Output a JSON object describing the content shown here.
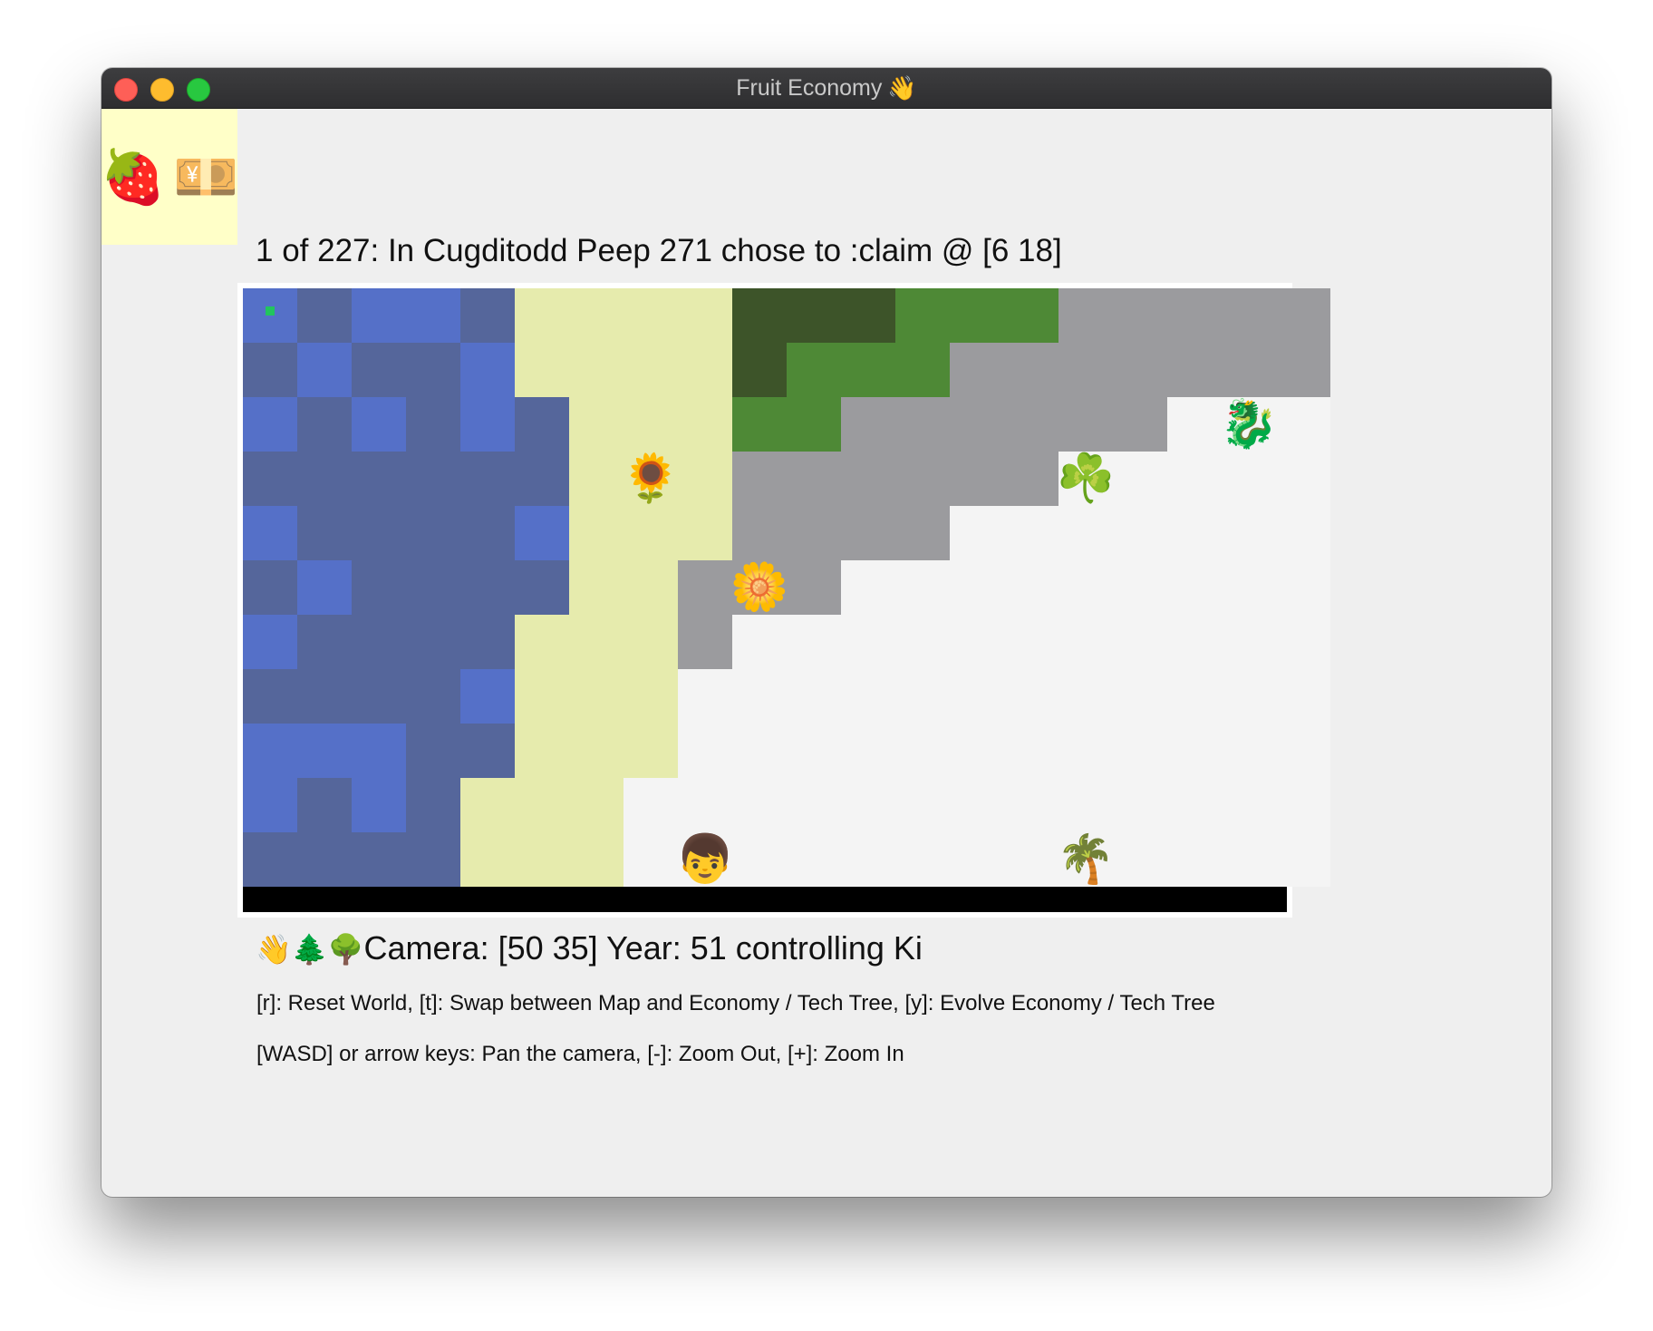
{
  "window": {
    "title": "Fruit Economy",
    "title_icon": "👋",
    "title_icon_name": "waving-hand-icon"
  },
  "resources": [
    {
      "name": "strawberry-icon",
      "glyph": "🍓"
    },
    {
      "name": "yen-banknote-icon",
      "glyph": "💴"
    }
  ],
  "event_log": "1 of 227: In Cugditodd Peep 271 chose to :claim @ [6 18]",
  "map": {
    "palette": {
      "W": "#5570c8",
      "D": "#55669b",
      "S": "#e6ebad",
      "F": "#3d5429",
      "G": "#4e8936",
      "R": "#9b9b9e",
      "N": "#f4f4f4"
    },
    "rows": [
      "WDWWDSSSSFFFGGGRRRRR",
      "DWDDWSSSSFGGGRRRRRRR",
      "WDWDWDSSSGGRRRRRRNNN",
      "DDDDDDSSSRRRRRRNNNNN",
      "WDDDDWSSSRRRRNNNNNNN",
      "DWDDDDSSRRRNNNNNNNNN",
      "WDDDDSSSRNNNNNNNNNNN",
      "DDDDWSSSNNNNNNNNNNNN",
      "WWWDDSSSNNNNNNNNNNNN",
      "WDWDSSSNNNNNNNNNNNNN",
      "DDDDSSSNNNNNNNNNNNNN"
    ],
    "sprites": [
      {
        "name": "sunflower-icon",
        "glyph": "🌻",
        "col": 7,
        "row": 3
      },
      {
        "name": "blossom-icon",
        "glyph": "🌼",
        "col": 9,
        "row": 5
      },
      {
        "name": "shamrock-icon",
        "glyph": "☘️",
        "col": 15,
        "row": 3
      },
      {
        "name": "dragon-icon",
        "glyph": "🐉",
        "col": 18,
        "row": 2
      },
      {
        "name": "person-icon",
        "glyph": "👦",
        "col": 8,
        "row": 10
      },
      {
        "name": "palm-tree-icon",
        "glyph": "🌴",
        "col": 15,
        "row": 10
      }
    ],
    "marker": {
      "col": 0,
      "row": 0,
      "color": "#22c55e"
    }
  },
  "status": {
    "icons": [
      {
        "name": "waving-hand-icon",
        "glyph": "👋"
      },
      {
        "name": "evergreen-tree-icon",
        "glyph": "🌲"
      },
      {
        "name": "deciduous-tree-icon",
        "glyph": "🌳"
      }
    ],
    "text": "Camera: [50 35] Year: 51 controlling Ki"
  },
  "help": {
    "line1": "[r]: Reset World, [t]: Swap between Map and Economy / Tech Tree, [y]: Evolve Economy / Tech Tree",
    "line2": "[WASD] or arrow keys: Pan the camera, [-]: Zoom Out, [+]: Zoom In"
  }
}
